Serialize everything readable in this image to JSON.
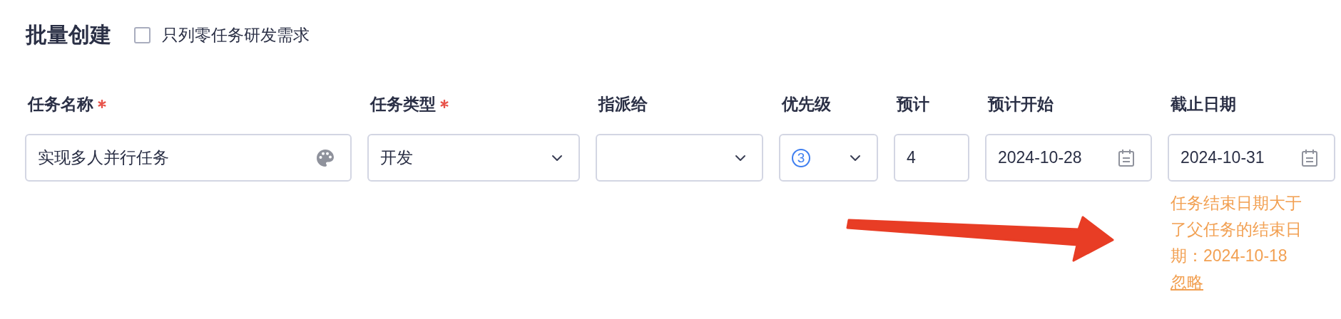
{
  "title": "批量创建",
  "filter": {
    "label": "只列零任务研发需求",
    "checked": false
  },
  "columns": [
    {
      "label": "任务名称",
      "required": true
    },
    {
      "label": "任务类型",
      "required": true
    },
    {
      "label": "指派给",
      "required": false
    },
    {
      "label": "优先级",
      "required": false
    },
    {
      "label": "预计",
      "required": false
    },
    {
      "label": "预计开始",
      "required": false
    },
    {
      "label": "截止日期",
      "required": false
    }
  ],
  "fields": [
    {
      "kind": "text",
      "value": "实现多人并行任务"
    },
    {
      "kind": "select",
      "value": "开发"
    },
    {
      "kind": "select"
    },
    {
      "kind": "priority",
      "value": "3"
    },
    {
      "kind": "number",
      "value": "4"
    },
    {
      "kind": "date",
      "value": "2024-10-28"
    },
    {
      "kind": "date",
      "value": "2024-10-31"
    }
  ],
  "warning": {
    "text": "任务结束日期大于了父任务的结束日期：2024-10-18",
    "link": "忽略"
  }
}
